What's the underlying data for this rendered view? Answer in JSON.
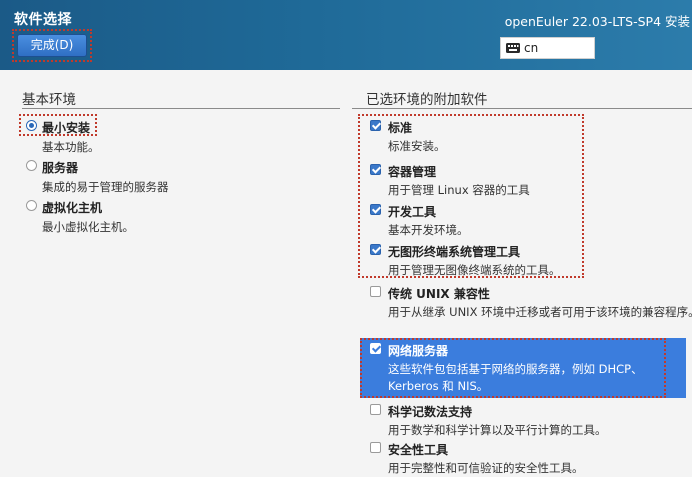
{
  "header": {
    "title": "软件选择",
    "done_label": "完成(D)",
    "product": "openEuler 22.03-LTS-SP4 安装",
    "keyboard_layout": "cn",
    "keyboard_icon": "keyboard-icon"
  },
  "base_env": {
    "title": "基本环境",
    "items": [
      {
        "name": "最小安装",
        "desc": "基本功能。",
        "selected": true
      },
      {
        "name": "服务器",
        "desc": "集成的易于管理的服务器",
        "selected": false
      },
      {
        "name": "虚拟化主机",
        "desc": "最小虚拟化主机。",
        "selected": false
      }
    ]
  },
  "addons": {
    "title": "已选环境的附加软件",
    "items": [
      {
        "name": "标准",
        "desc": "标准安装。",
        "checked": true
      },
      {
        "name": "容器管理",
        "desc": "用于管理 Linux 容器的工具",
        "checked": true
      },
      {
        "name": "开发工具",
        "desc": "基本开发环境。",
        "checked": true
      },
      {
        "name": "无图形终端系统管理工具",
        "desc": "用于管理无图像终端系统的工具。",
        "checked": true
      },
      {
        "name": "传统 UNIX 兼容性",
        "desc": "用于从继承 UNIX 环境中迁移或者可用于该环境的兼容程序。",
        "checked": false
      },
      {
        "name": "网络服务器",
        "desc": "这些软件包包括基于网络的服务器，例如 DHCP、Kerberos 和 NIS。",
        "checked": true,
        "highlighted": true
      },
      {
        "name": "科学记数法支持",
        "desc": "用于数学和科学计算以及平行计算的工具。",
        "checked": false
      },
      {
        "name": "安全性工具",
        "desc": "用于完整性和可信验证的安全性工具。",
        "checked": false
      }
    ]
  },
  "colors": {
    "header_bg": "#1f6a98",
    "accent": "#3b7ddd",
    "annotation": "#c0392b"
  }
}
